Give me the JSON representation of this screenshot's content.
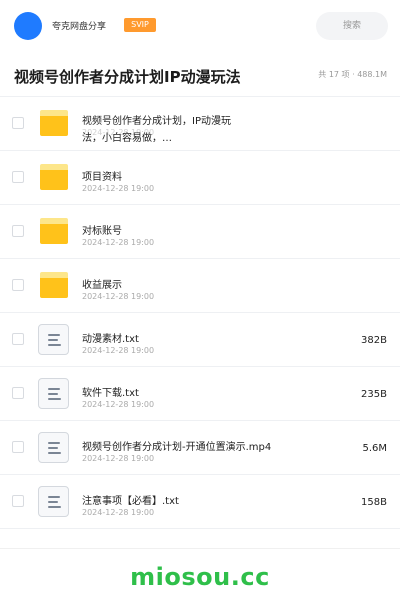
{
  "header": {
    "site_name": "夸克网盘分享",
    "vip_label": "SVIP",
    "search_placeholder": "搜索"
  },
  "page": {
    "title": "视频号创作者分成计划IP动漫玩法",
    "summary": "共 17 项 · 488.1M"
  },
  "files": [
    {
      "name": "视频号创作者分成计划，IP动漫玩法，小白容易做，…",
      "date": "2024-12-28 19:00",
      "size": "",
      "kind": "folder"
    },
    {
      "name": "项目资料",
      "date": "2024-12-28 19:00",
      "size": "",
      "kind": "folder"
    },
    {
      "name": "对标账号",
      "date": "2024-12-28 19:00",
      "size": "",
      "kind": "folder"
    },
    {
      "name": "收益展示",
      "date": "2024-12-28 19:00",
      "size": "",
      "kind": "folder"
    },
    {
      "name": "动漫素材.txt",
      "date": "2024-12-28 19:00",
      "size": "382B",
      "kind": "document"
    },
    {
      "name": "软件下载.txt",
      "date": "2024-12-28 19:00",
      "size": "235B",
      "kind": "document"
    },
    {
      "name": "视频号创作者分成计划-开通位置演示.mp4",
      "date": "2024-12-28 19:00",
      "size": "5.6M",
      "kind": "document"
    },
    {
      "name": "注意事项【必看】.txt",
      "date": "2024-12-28 19:00",
      "size": "158B",
      "kind": "document"
    }
  ],
  "footer": {
    "watermark": "miosou.cc"
  },
  "colors": {
    "accent": "#1f7bff",
    "vip": "#ff9a2e",
    "folder": "#ffc21a",
    "watermark": "#2fbf4a"
  },
  "icons": {
    "folder": "folder-icon",
    "document": "document-icon"
  }
}
